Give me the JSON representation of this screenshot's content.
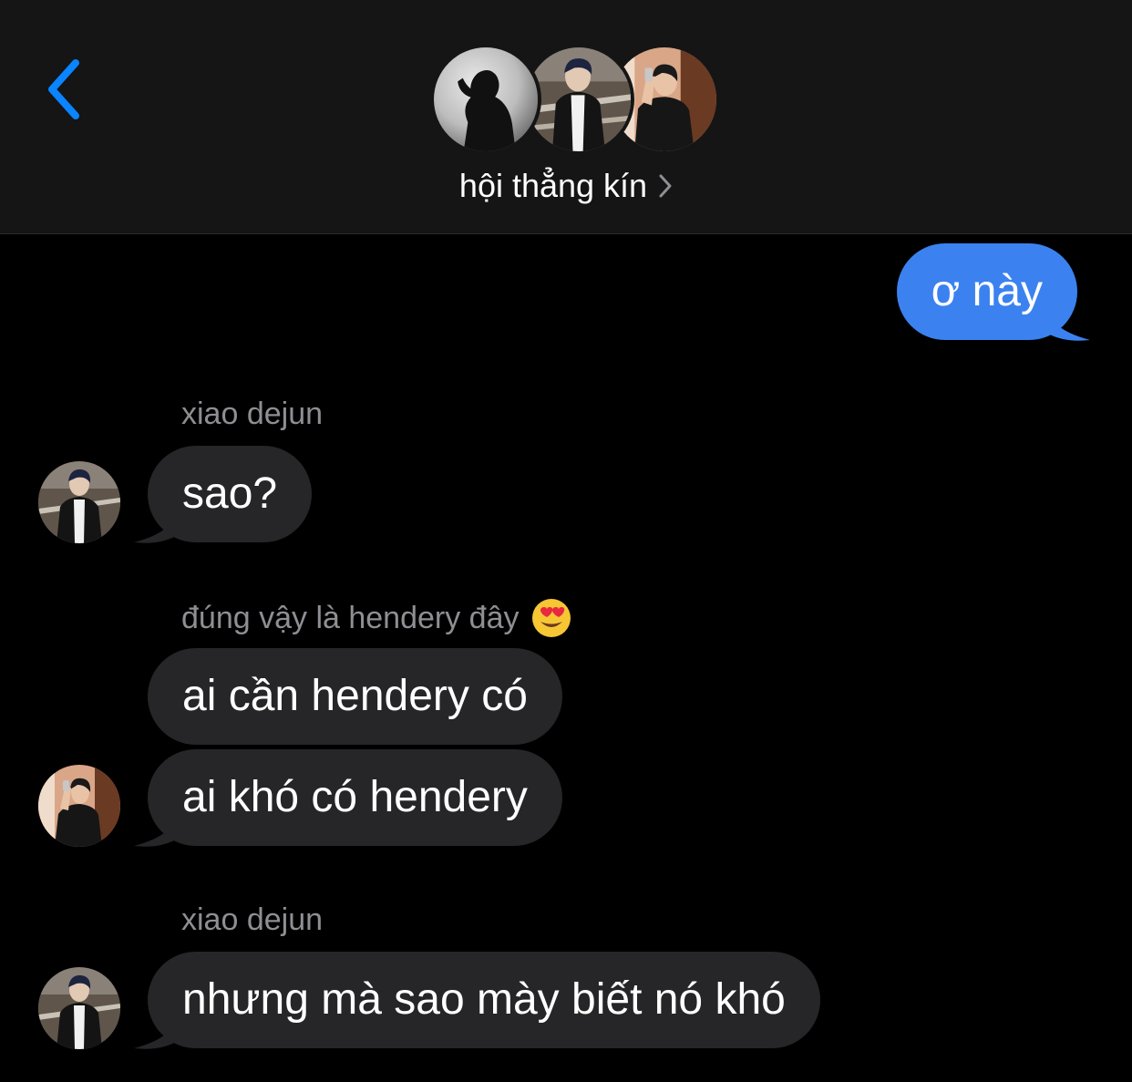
{
  "header": {
    "group_name": "hội thẳng kín",
    "back_label": "",
    "accent_color": "#0a84ff"
  },
  "messages": [
    {
      "direction": "outgoing",
      "text": "ơ này"
    },
    {
      "direction": "incoming",
      "sender": "xiao dejun",
      "text": "sao?"
    },
    {
      "direction": "incoming",
      "sender": "đúng vậy là hendery đây",
      "text": "ai cần hendery có"
    },
    {
      "direction": "incoming",
      "text": "ai khó có hendery"
    },
    {
      "direction": "incoming",
      "sender": "xiao dejun",
      "text": "nhưng mà sao mày biết nó khó"
    }
  ],
  "colors": {
    "outgoing_bubble": "#3b82f0",
    "incoming_bubble": "#262628",
    "background": "#000000",
    "header_background": "#151515",
    "sender_name": "#8e8e93"
  },
  "icons": {
    "back": "chevron-left-icon",
    "group_details": "chevron-right-icon",
    "sender_emoji": "heart-eyes-emoji-icon"
  }
}
